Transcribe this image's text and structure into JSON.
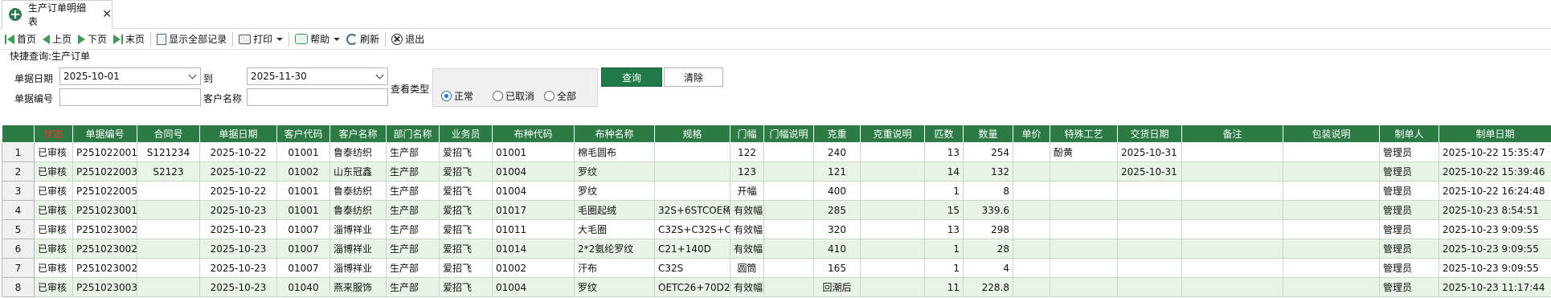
{
  "tab": {
    "label": "生产订单明细表",
    "close": "✕"
  },
  "toolbar": {
    "first": "首页",
    "prev": "上页",
    "next": "下页",
    "last": "末页",
    "show_all": "显示全部记录",
    "print": "打印",
    "help": "帮助",
    "refresh": "刷新",
    "exit": "退出"
  },
  "query": {
    "title": "快捷查询:生产订单",
    "date_label": "单据日期",
    "date_from": "2025-10-01",
    "to_label": "到",
    "date_to": "2025-11-30",
    "view_type_label": "查看类型",
    "doc_no_label": "单据编号",
    "doc_no_value": "",
    "customer_label": "客户名称",
    "customer_value": "",
    "radios": {
      "normal": "正常",
      "cancelled": "已取消",
      "all": "全部"
    },
    "query_button": "查询",
    "clear_button": "清除"
  },
  "table": {
    "columns": [
      "状态",
      "单据编号",
      "合同号",
      "单据日期",
      "客户代码",
      "客户名称",
      "部门名称",
      "业务员",
      "布种代码",
      "布种名称",
      "规格",
      "门幅",
      "门幅说明",
      "克重",
      "克重说明",
      "匹数",
      "数量",
      "单价",
      "特殊工艺",
      "交货日期",
      "备注",
      "包装说明",
      "制单人",
      "制单日期"
    ],
    "rows": [
      [
        "1",
        "已审核",
        "P251022001",
        "S121234",
        "2025-10-22",
        "01001",
        "鲁泰纺织",
        "生产部",
        "爱招飞",
        "01001",
        "棉毛圆布",
        "",
        "122",
        "",
        "240",
        "",
        "13",
        "254",
        "",
        "酚黄",
        "2025-10-31",
        "",
        "",
        "管理员",
        "2025-10-22 15:35:47"
      ],
      [
        "2",
        "已审核",
        "P251022003",
        "S2123",
        "2025-10-22",
        "01002",
        "山东冠鑫",
        "生产部",
        "爱招飞",
        "01004",
        "罗纹",
        "",
        "123",
        "",
        "121",
        "",
        "14",
        "132",
        "",
        "",
        "2025-10-31",
        "",
        "",
        "管理员",
        "2025-10-22 15:39:46"
      ],
      [
        "3",
        "已审核",
        "P251022005",
        "",
        "2025-10-22",
        "01001",
        "鲁泰纺织",
        "生产部",
        "爱招飞",
        "01004",
        "罗纹",
        "",
        "开幅",
        "",
        "400",
        "",
        "1",
        "8",
        "",
        "",
        "",
        "",
        "",
        "管理员",
        "2025-10-22 16:24:48"
      ],
      [
        "4",
        "已审核",
        "P251023001",
        "",
        "2025-10-23",
        "01001",
        "鲁泰纺织",
        "生产部",
        "爱招飞",
        "01017",
        "毛圈起绒",
        "32S+6STCOE稀",
        "有效幅",
        "",
        "285",
        "",
        "15",
        "339.6",
        "",
        "",
        "",
        "",
        "",
        "管理员",
        "2025-10-23 8:54:51"
      ],
      [
        "5",
        "已审核",
        "P251023002",
        "",
        "2025-10-23",
        "01007",
        "淄博祥业",
        "生产部",
        "爱招飞",
        "01011",
        "大毛圈",
        "C32S+C32S+C",
        "有效幅",
        "",
        "320",
        "",
        "13",
        "298",
        "",
        "",
        "",
        "",
        "",
        "管理员",
        "2025-10-23 9:09:55"
      ],
      [
        "6",
        "已审核",
        "P251023002",
        "",
        "2025-10-23",
        "01007",
        "淄博祥业",
        "生产部",
        "爱招飞",
        "01014",
        "2*2氨纶罗纹",
        "C21+140D",
        "有效幅",
        "",
        "410",
        "",
        "1",
        "28",
        "",
        "",
        "",
        "",
        "",
        "管理员",
        "2025-10-23 9:09:55"
      ],
      [
        "7",
        "已审核",
        "P251023002",
        "",
        "2025-10-23",
        "01007",
        "淄博祥业",
        "生产部",
        "爱招飞",
        "01002",
        "汗布",
        "C32S",
        "圆筒",
        "",
        "165",
        "",
        "1",
        "4",
        "",
        "",
        "",
        "",
        "",
        "管理员",
        "2025-10-23 9:09:55"
      ],
      [
        "8",
        "已审核",
        "P251023003",
        "",
        "2025-10-23",
        "01040",
        "燕来服饰",
        "生产部",
        "爱招飞",
        "01004",
        "罗纹",
        "OETC26+70D2",
        "有效幅",
        "",
        "回潮后",
        "",
        "11",
        "228.8",
        "",
        "",
        "",
        "",
        "",
        "管理员",
        "2025-10-23 11:17:44"
      ]
    ]
  },
  "colors": {
    "header_green": "#2c7a44",
    "alt_row": "#e8f5e6",
    "status_header": "#ff3333",
    "query_button": "#21794a"
  }
}
